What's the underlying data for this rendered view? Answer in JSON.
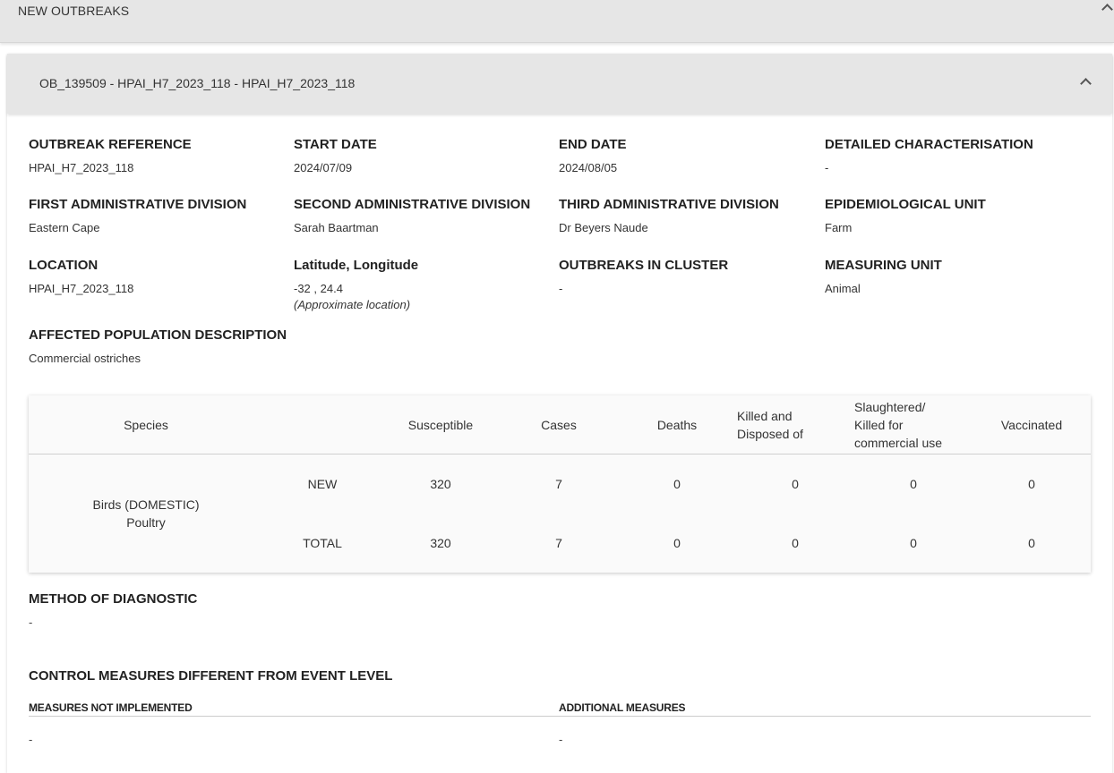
{
  "top_bar": {
    "title": "NEW OUTBREAKS"
  },
  "outbreak": {
    "header": "OB_139509 - HPAI_H7_2023_118 - HPAI_H7_2023_118",
    "fields": {
      "outbreak_reference": {
        "label": "OUTBREAK REFERENCE",
        "value": "HPAI_H7_2023_118"
      },
      "start_date": {
        "label": "START DATE",
        "value": "2024/07/09"
      },
      "end_date": {
        "label": "END DATE",
        "value": "2024/08/05"
      },
      "detailed_characterisation": {
        "label": "DETAILED CHARACTERISATION",
        "value": "-"
      },
      "first_admin_division": {
        "label": "FIRST ADMINISTRATIVE DIVISION",
        "value": "Eastern Cape"
      },
      "second_admin_division": {
        "label": "SECOND ADMINISTRATIVE DIVISION",
        "value": "Sarah Baartman"
      },
      "third_admin_division": {
        "label": "THIRD ADMINISTRATIVE DIVISION",
        "value": "Dr Beyers Naude"
      },
      "epidemiological_unit": {
        "label": "EPIDEMIOLOGICAL UNIT",
        "value": "Farm"
      },
      "location": {
        "label": "LOCATION",
        "value": "HPAI_H7_2023_118"
      },
      "lat_long": {
        "label": "Latitude, Longitude",
        "value": "-32 , 24.4",
        "note": "(Approximate location)"
      },
      "outbreaks_in_cluster": {
        "label": "OUTBREAKS IN CLUSTER",
        "value": "-"
      },
      "measuring_unit": {
        "label": "MEASURING UNIT",
        "value": "Animal"
      },
      "affected_population": {
        "label": "AFFECTED POPULATION DESCRIPTION",
        "value": "Commercial ostriches"
      }
    },
    "table": {
      "headers": {
        "species": "Species",
        "susceptible": "Susceptible",
        "cases": "Cases",
        "deaths": "Deaths",
        "killed_line1": "Killed and",
        "killed_line2": "Disposed of",
        "slaughtered_line1": "Slaughtered/",
        "slaughtered_line2": "Killed for",
        "slaughtered_line3": "commercial use",
        "vaccinated": "Vaccinated"
      },
      "species_line1": "Birds (DOMESTIC)",
      "species_line2": "Poultry",
      "rows": [
        {
          "type": "NEW",
          "susceptible": "320",
          "cases": "7",
          "deaths": "0",
          "killed": "0",
          "slaughtered": "0",
          "vaccinated": "0"
        },
        {
          "type": "TOTAL",
          "susceptible": "320",
          "cases": "7",
          "deaths": "0",
          "killed": "0",
          "slaughtered": "0",
          "vaccinated": "0"
        }
      ]
    },
    "method_of_diagnostic": {
      "label": "METHOD OF DIAGNOSTIC",
      "value": "-"
    },
    "control_measures": {
      "title": "CONTROL MEASURES DIFFERENT FROM EVENT LEVEL",
      "not_implemented": {
        "label": "MEASURES NOT IMPLEMENTED",
        "value": "-"
      },
      "additional": {
        "label": "ADDITIONAL MEASURES",
        "value": "-"
      }
    }
  }
}
